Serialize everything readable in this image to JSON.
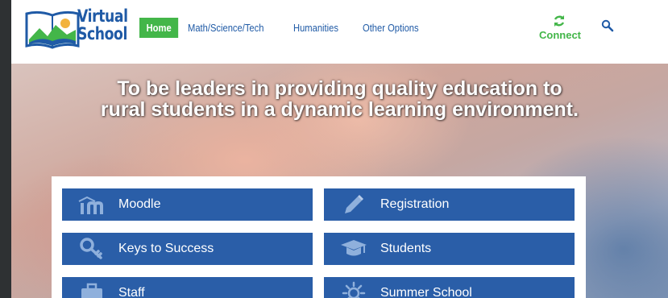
{
  "brand": {
    "line1": "Virtual",
    "line2": "School"
  },
  "nav": {
    "items": [
      {
        "label": "Home",
        "active": true
      },
      {
        "label": "Math/Science/Tech",
        "active": false
      },
      {
        "label": "Humanities",
        "active": false
      },
      {
        "label": "Other Options",
        "active": false
      }
    ]
  },
  "connect": {
    "label": "Connect",
    "icon": "refresh-icon"
  },
  "search": {
    "icon": "search-icon"
  },
  "hero": {
    "line1": "To be leaders in providing quality education to",
    "line2": "rural students in a dynamic learning environment."
  },
  "tiles": [
    {
      "label": "Moodle",
      "icon": "moodle-icon"
    },
    {
      "label": "Registration",
      "icon": "pencil-icon"
    },
    {
      "label": "Keys to Success",
      "icon": "key-icon"
    },
    {
      "label": "Students",
      "icon": "graduation-cap-icon"
    },
    {
      "label": "Staff",
      "icon": "briefcase-icon"
    },
    {
      "label": "Summer School",
      "icon": "sun-icon"
    }
  ],
  "colors": {
    "brand_blue": "#1f5aa6",
    "accent_green": "#43b649",
    "tile_blue": "#2a5ea8",
    "frame": "#2e3133"
  }
}
